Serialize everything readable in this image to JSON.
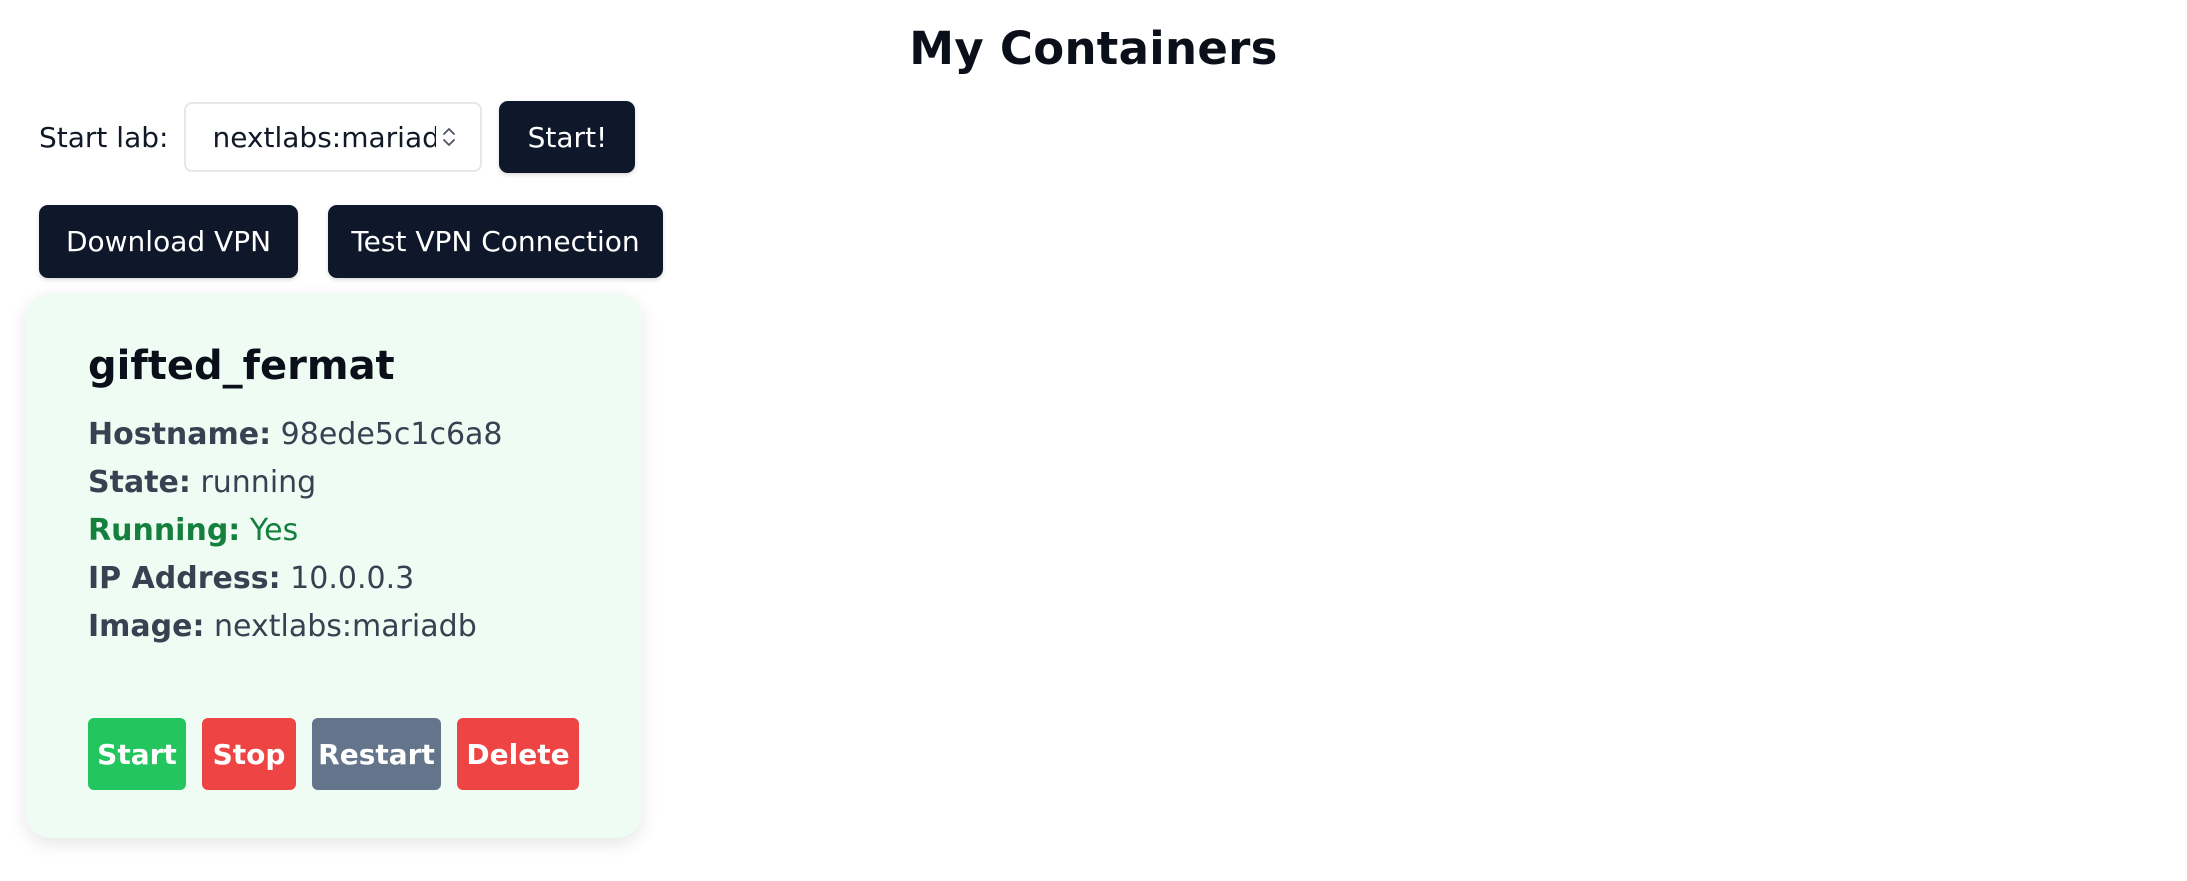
{
  "page": {
    "title": "My Containers"
  },
  "lab_picker": {
    "label": "Start lab:",
    "selected": "nextlabs:mariadb",
    "start_button": "Start!"
  },
  "vpn": {
    "download_button": "Download VPN",
    "test_button": "Test VPN Connection"
  },
  "container": {
    "name": "gifted_fermat",
    "fields": [
      {
        "key": "Hostname:",
        "value": "98ede5c1c6a8"
      },
      {
        "key": "State:",
        "value": "running"
      },
      {
        "key": "Running:",
        "value": "Yes"
      },
      {
        "key": "IP Address:",
        "value": "10.0.0.3"
      },
      {
        "key": "Image:",
        "value": "nextlabs:mariadb"
      }
    ],
    "actions": {
      "start": "Start",
      "stop": "Stop",
      "restart": "Restart",
      "delete": "Delete"
    }
  },
  "colors": {
    "dark_button": "#0f172a",
    "card_background": "#effcf3",
    "running_green": "#15803d",
    "start_green": "#22c55e",
    "danger_red": "#ef4444",
    "restart_slate": "#64748b"
  }
}
